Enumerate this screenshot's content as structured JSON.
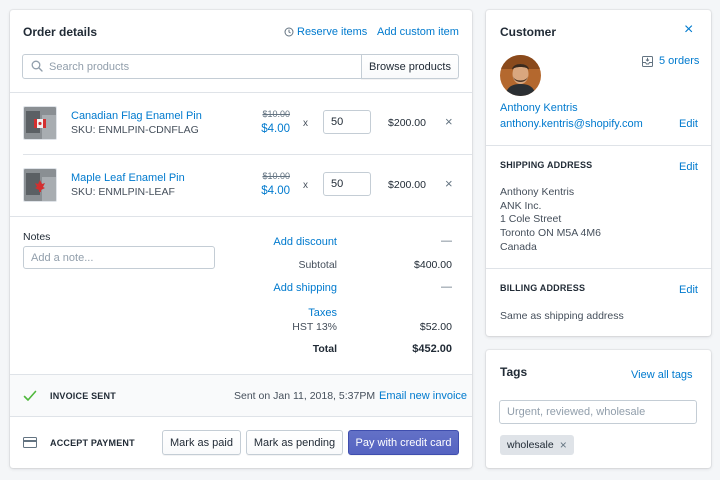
{
  "order": {
    "title": "Order details",
    "reserve_items": "Reserve items",
    "add_custom_item": "Add custom item",
    "search_placeholder": "Search products",
    "browse_products": "Browse products",
    "line_items": [
      {
        "name": "Canadian Flag Enamel Pin",
        "sku": "SKU: ENMLPIN-CDNFLAG",
        "original_price": "$10.00",
        "price": "$4.00",
        "times": "x",
        "quantity": "50",
        "total": "$200.00",
        "remove": "×"
      },
      {
        "name": "Maple Leaf Enamel Pin",
        "sku": "SKU: ENMLPIN-LEAF",
        "original_price": "$10.00",
        "price": "$4.00",
        "times": "x",
        "quantity": "50",
        "total": "$200.00",
        "remove": "×"
      }
    ],
    "notes_label": "Notes",
    "notes_placeholder": "Add a note...",
    "add_discount": "Add discount",
    "discount_value": "—",
    "subtotal_label": "Subtotal",
    "subtotal_value": "$400.00",
    "add_shipping": "Add shipping",
    "shipping_value": "—",
    "taxes_label": "Taxes",
    "tax_name": "HST 13%",
    "tax_value": "$52.00",
    "total_label": "Total",
    "total_value": "$452.00",
    "invoice_status": "INVOICE SENT",
    "invoice_sent_on": "Sent on Jan 11, 2018, 5:37PM",
    "email_new_invoice": "Email new invoice",
    "accept_payment": "ACCEPT PAYMENT",
    "mark_as_paid": "Mark as paid",
    "mark_as_pending": "Mark as pending",
    "pay_with_credit_card": "Pay with credit card"
  },
  "customer": {
    "title": "Customer",
    "close": "×",
    "orders": "5 orders",
    "name": "Anthony Kentris",
    "email": "anthony.kentris@shopify.com",
    "edit": "Edit",
    "shipping_title": "SHIPPING ADDRESS",
    "shipping_edit": "Edit",
    "shipping_lines": [
      "Anthony Kentris",
      "ANK Inc.",
      "1 Cole Street",
      "Toronto ON M5A 4M6",
      "Canada"
    ],
    "billing_title": "BILLING ADDRESS",
    "billing_edit": "Edit",
    "billing_text": "Same as shipping address"
  },
  "tags": {
    "title": "Tags",
    "view_all": "View all tags",
    "placeholder": "Urgent, reviewed, wholesale",
    "items": [
      {
        "label": "wholesale",
        "remove": "×"
      }
    ]
  },
  "colors": {
    "link": "#007ace",
    "primary_button": "#5c6ac4",
    "check": "#50b83c",
    "background": "#f4f6f8"
  },
  "icons": [
    "search-icon",
    "clock-icon",
    "close-icon",
    "orders-icon",
    "checkmark-icon",
    "credit-card-icon",
    "remove-icon"
  ]
}
